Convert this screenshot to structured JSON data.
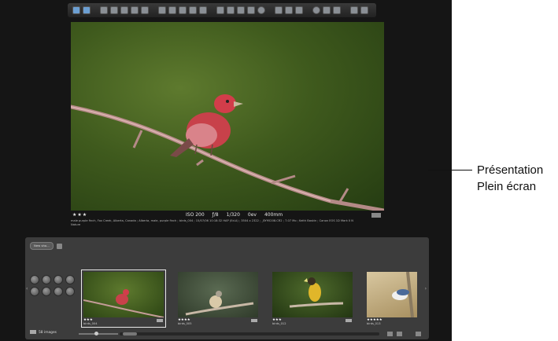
{
  "photo": {
    "rating": "★★★",
    "iso": "ISO 200",
    "aperture": "ƒ/8",
    "shutter": "1/320",
    "exposure": "0ev",
    "focal": "400mm",
    "caption_line1": "male purple finch, Fox Creek, Alberta, Canada ; Alberta, male, purple finch ; birds_004 ; 15/07/06 10:18:32 HAP (Ed.A) ; 3504 x 2322 ; _BY95208.CR2 ; 7.07 Mo ; Keith Baskin ; Canon EOS 1D Mark II N",
    "caption_line2": "Nature"
  },
  "filmstrip": {
    "filter_label": "New sho...",
    "image_count": "58 images",
    "thumbnails": [
      {
        "stars": "★★★",
        "name": "birds_004"
      },
      {
        "stars": "★★★★",
        "name": "birds_005"
      },
      {
        "stars": "★★★",
        "name": "birds_012"
      },
      {
        "stars": "★★★★★",
        "name": "birds_013"
      }
    ]
  },
  "callout": {
    "line1": "Présentation",
    "line2": "Plein écran"
  },
  "colors": {
    "screen_bg": "#151515",
    "filmstrip_bg": "#3c3c3c"
  }
}
